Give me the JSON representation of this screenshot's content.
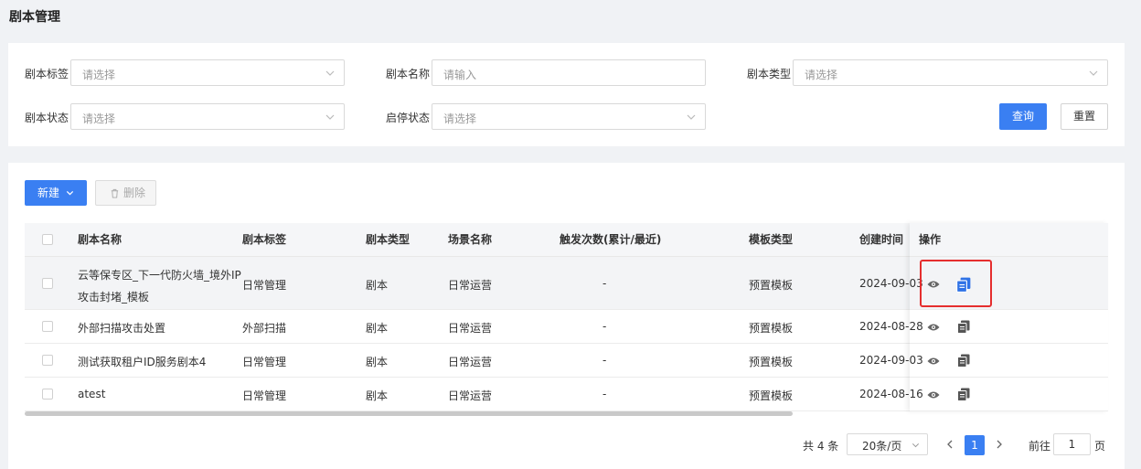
{
  "page_title": "剧本管理",
  "filters": {
    "tag_label": "剧本标签",
    "tag_placeholder": "请选择",
    "name_label": "剧本名称",
    "name_placeholder": "请输入",
    "type_label": "剧本类型",
    "type_placeholder": "请选择",
    "status_label": "剧本状态",
    "status_placeholder": "请选择",
    "enable_label": "启停状态",
    "enable_placeholder": "请选择",
    "query_button": "查询",
    "reset_button": "重置"
  },
  "toolbar": {
    "new_button": "新建",
    "delete_button": "删除"
  },
  "table": {
    "columns": [
      "剧本名称",
      "剧本标签",
      "剧本类型",
      "场景名称",
      "触发次数(累计/最近)",
      "模板类型",
      "创建时间",
      "操作"
    ],
    "rows": [
      {
        "name_line1": "云等保专区_下一代防火墙_境外IP",
        "name_line2": "攻击封堵_模板",
        "tag": "日常管理",
        "type": "剧本",
        "scene": "日常运营",
        "trigger": "-",
        "template": "预置模板",
        "created": "2024-09-03"
      },
      {
        "name": "外部扫描攻击处置",
        "tag": "外部扫描",
        "type": "剧本",
        "scene": "日常运营",
        "trigger": "-",
        "template": "预置模板",
        "created": "2024-08-28"
      },
      {
        "name": "测试获取租户ID服务剧本4",
        "tag": "日常管理",
        "type": "剧本",
        "scene": "日常运营",
        "trigger": "-",
        "template": "预置模板",
        "created": "2024-09-03"
      },
      {
        "name": "atest",
        "tag": "日常管理",
        "type": "剧本",
        "scene": "日常运营",
        "trigger": "-",
        "template": "预置模板",
        "created": "2024-08-16"
      }
    ]
  },
  "pagination": {
    "total_text": "共 4 条",
    "page_size": "20条/页",
    "current_page": "1",
    "goto_label": "前往",
    "goto_value": "1",
    "page_unit": "页"
  },
  "colors": {
    "primary": "#3a7ff2",
    "highlight_border": "#e52e2e"
  }
}
